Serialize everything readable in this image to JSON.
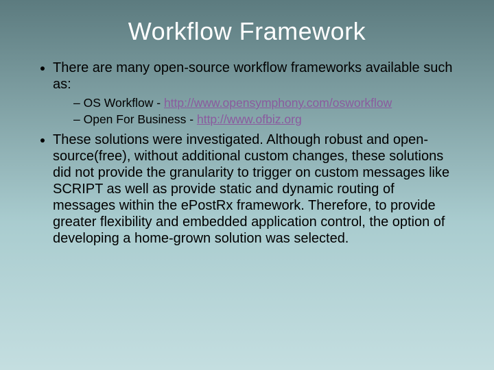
{
  "title": "Workflow Framework",
  "bullets": {
    "b1": "There are many open-source workflow frameworks available such as:",
    "sub1_prefix": "OS Workflow - ",
    "sub1_link": "http://www.opensymphony.com/osworkflow",
    "sub2_prefix": "Open For Business - ",
    "sub2_link": "http://www.ofbiz.org",
    "b2": "These solutions were investigated. Although robust and open-source(free), without additional custom changes, these solutions did not provide the granularity to trigger on custom messages like SCRIPT as well as provide static and dynamic routing of messages within the ePostRx framework.  Therefore, to provide greater flexibility and embedded application control, the option of developing a home-grown solution was selected."
  }
}
